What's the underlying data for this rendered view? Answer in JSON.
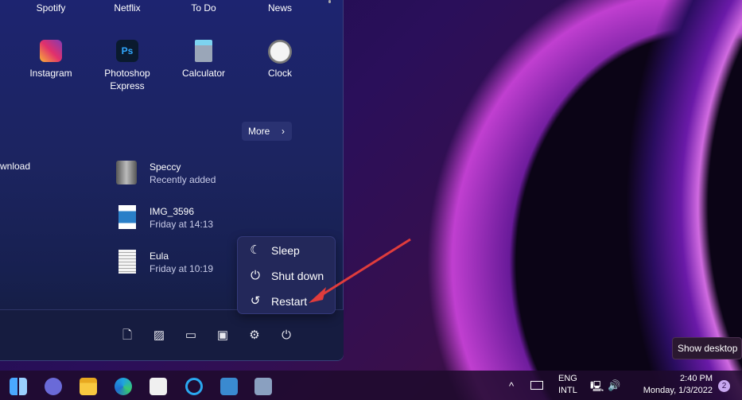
{
  "pinned_row1": [
    "Spotify",
    "Netflix",
    "To Do",
    "News"
  ],
  "pinned_row2": [
    {
      "label": "Instagram"
    },
    {
      "label": "Photoshop Express"
    },
    {
      "label": "Calculator"
    },
    {
      "label": "Clock"
    }
  ],
  "recommended": {
    "more_label": "More",
    "partial_left": "wnload",
    "items": [
      {
        "name": "Speccy",
        "sub": "Recently added"
      },
      {
        "name": "IMG_3596",
        "sub": "Friday at 14:13"
      },
      {
        "name": "Eula",
        "sub": "Friday at 10:19"
      }
    ]
  },
  "power_menu": [
    "Sleep",
    "Shut down",
    "Restart"
  ],
  "footer_icons": [
    "documents-icon",
    "pictures-icon",
    "videos-icon",
    "user-folder-icon",
    "settings-icon",
    "power-icon"
  ],
  "tooltip": "Show desktop",
  "tray": {
    "lang1": "ENG",
    "lang2": "INTL",
    "time": "2:40 PM",
    "date": "Monday, 1/3/2022",
    "notifications": "2"
  },
  "colors": {
    "arrow": "#e03c3c",
    "accent": "#2a3272"
  }
}
